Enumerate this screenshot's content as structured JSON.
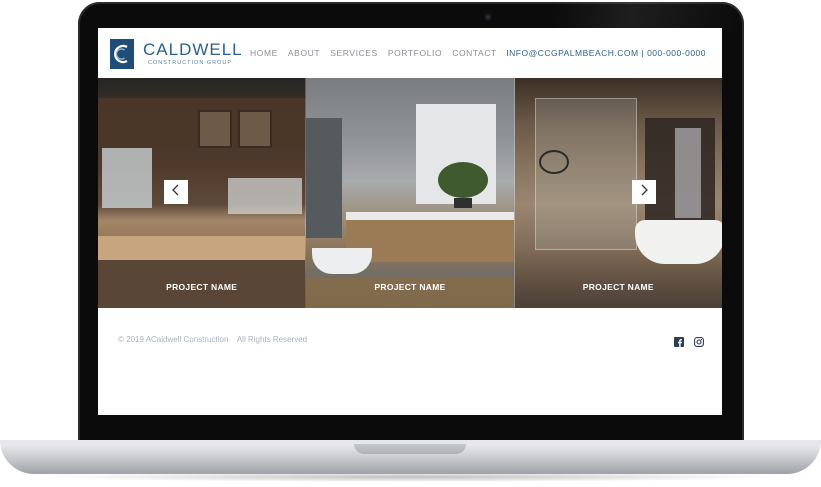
{
  "brand": {
    "name": "CALDWELL",
    "tagline": "CONSTRUCTION GROUP"
  },
  "nav": {
    "items": [
      "HOME",
      "ABOUT",
      "SERVICES",
      "PORTFOLIO",
      "CONTACT"
    ]
  },
  "contact": {
    "email": "INFO@CCGPALMBEACH.COM",
    "separator": "|",
    "phone": "000-000-0000"
  },
  "gallery": {
    "projects": [
      {
        "caption": "PROJECT NAME"
      },
      {
        "caption": "PROJECT NAME"
      },
      {
        "caption": "PROJECT NAME"
      }
    ],
    "prev_icon": "chevron-left-icon",
    "next_icon": "chevron-right-icon"
  },
  "footer": {
    "copyright": "© 2019 ACaldwell Construction    All Rights Reserved",
    "social": [
      "facebook-icon",
      "instagram-icon"
    ]
  },
  "colors": {
    "brand_blue": "#1f4d77",
    "link_blue": "#2b5f8c",
    "nav_gray": "#8a8f96"
  }
}
